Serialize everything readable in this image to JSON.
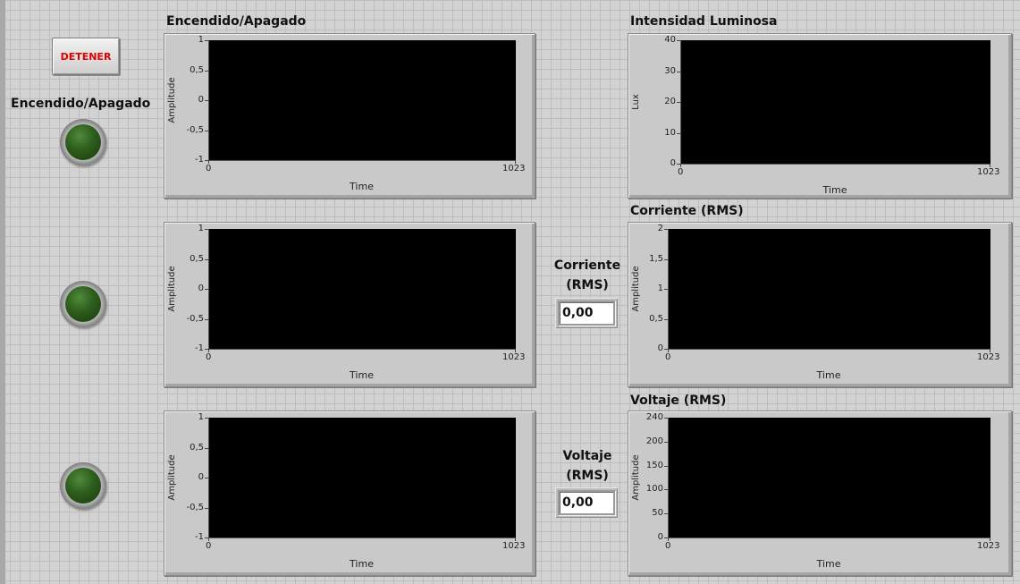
{
  "stop_button": {
    "label": "DETENER"
  },
  "led_section": {
    "label": "Encendido/Apagado"
  },
  "indicators": {
    "corriente": {
      "label_line1": "Corriente",
      "label_line2": "(RMS)",
      "value": "0,00"
    },
    "voltaje": {
      "label_line1": "Voltaje",
      "label_line2": "(RMS)",
      "value": "0,00"
    }
  },
  "graphs": [
    {
      "id": "g1",
      "title": "Encendido/Apagado",
      "ylabel": "Amplitude",
      "xlabel": "Time",
      "yticks": [
        "1",
        "0,5",
        "0",
        "-0,5",
        "-1"
      ],
      "xticks": [
        "0",
        "1023"
      ]
    },
    {
      "id": "g2",
      "title": "",
      "ylabel": "Amplitude",
      "xlabel": "Time",
      "yticks": [
        "1",
        "0,5",
        "0",
        "-0,5",
        "-1"
      ],
      "xticks": [
        "0",
        "1023"
      ]
    },
    {
      "id": "g3",
      "title": "",
      "ylabel": "Amplitude",
      "xlabel": "Time",
      "yticks": [
        "1",
        "0,5",
        "0",
        "-0,5",
        "-1"
      ],
      "xticks": [
        "0",
        "1023"
      ]
    },
    {
      "id": "g4",
      "title": "Intensidad Luminosa",
      "ylabel": "Lux",
      "xlabel": "Time",
      "yticks": [
        "40",
        "30",
        "20",
        "10",
        "0"
      ],
      "xticks": [
        "0",
        "1023"
      ]
    },
    {
      "id": "g5",
      "title": "Corriente (RMS)",
      "ylabel": "Amplitude",
      "xlabel": "Time",
      "yticks": [
        "2",
        "1,5",
        "1",
        "0,5",
        "0"
      ],
      "xticks": [
        "0",
        "1023"
      ]
    },
    {
      "id": "g6",
      "title": "Voltaje (RMS)",
      "ylabel": "Amplitude",
      "xlabel": "Time",
      "yticks": [
        "240",
        "200",
        "150",
        "100",
        "50",
        "0"
      ],
      "xticks": [
        "0",
        "1023"
      ]
    }
  ],
  "chart_data": [
    {
      "type": "line",
      "title": "Encendido/Apagado",
      "xlabel": "Time",
      "ylabel": "Amplitude",
      "xlim": [
        0,
        1023
      ],
      "ylim": [
        -1,
        1
      ],
      "series": []
    },
    {
      "type": "line",
      "title": "",
      "xlabel": "Time",
      "ylabel": "Amplitude",
      "xlim": [
        0,
        1023
      ],
      "ylim": [
        -1,
        1
      ],
      "series": []
    },
    {
      "type": "line",
      "title": "",
      "xlabel": "Time",
      "ylabel": "Amplitude",
      "xlim": [
        0,
        1023
      ],
      "ylim": [
        -1,
        1
      ],
      "series": []
    },
    {
      "type": "line",
      "title": "Intensidad Luminosa",
      "xlabel": "Time",
      "ylabel": "Lux",
      "xlim": [
        0,
        1023
      ],
      "ylim": [
        0,
        40
      ],
      "series": []
    },
    {
      "type": "line",
      "title": "Corriente (RMS)",
      "xlabel": "Time",
      "ylabel": "Amplitude",
      "xlim": [
        0,
        1023
      ],
      "ylim": [
        0,
        2
      ],
      "series": []
    },
    {
      "type": "line",
      "title": "Voltaje (RMS)",
      "xlabel": "Time",
      "ylabel": "Amplitude",
      "xlim": [
        0,
        1023
      ],
      "ylim": [
        0,
        240
      ],
      "series": []
    }
  ]
}
